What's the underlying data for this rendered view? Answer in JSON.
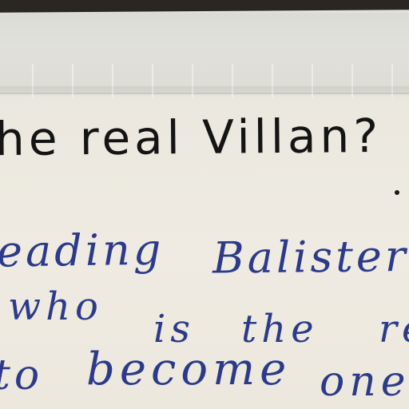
{
  "photo": {
    "heading": "he real Villan?",
    "handwriting": {
      "line1_a": "eading",
      "line1_b": "Balister's",
      "line2_a": "who",
      "line2_b": "is",
      "line2_c": "the",
      "line2_d": "re",
      "line3_a": "to",
      "line3_b": "become",
      "line3_c": "one"
    },
    "colors": {
      "paper": "#ece8de",
      "tape": "#dcdcd6",
      "heading_ink": "#141414",
      "handwriting_ink": "#2c3a8a"
    }
  }
}
